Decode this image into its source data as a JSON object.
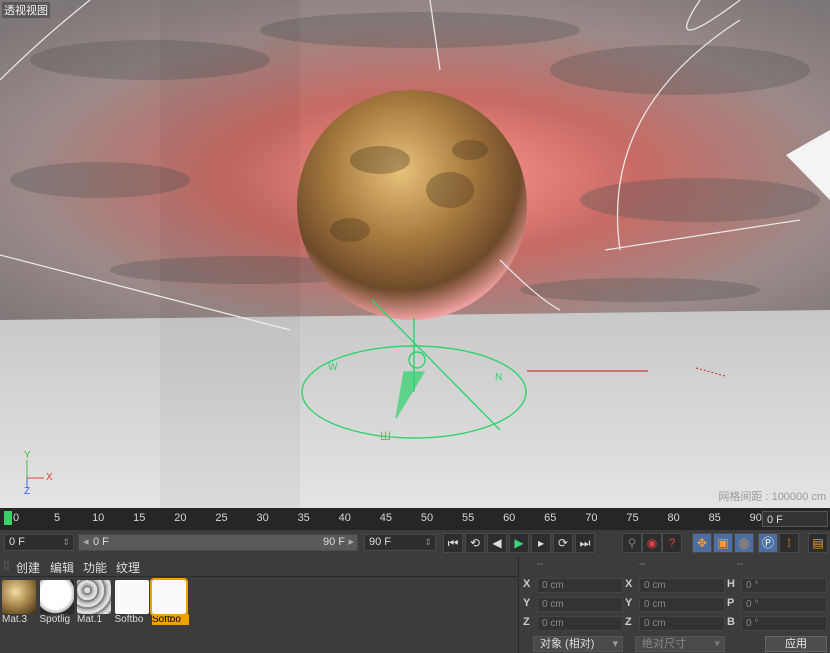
{
  "viewport": {
    "title": "透视视图",
    "grid_spacing": "网格间距 : 100000 cm",
    "axes": {
      "y": "Y",
      "x": "X",
      "z": "Z"
    },
    "colors": {
      "sky_red": "#e0716a",
      "ground": "#d9d9d9",
      "selection": "#2fd36d",
      "axis_x": "#e04040",
      "axis_y": "#40c040",
      "axis_z": "#4060ff"
    }
  },
  "timeline": {
    "ticks": [
      "0",
      "5",
      "10",
      "15",
      "20",
      "25",
      "30",
      "35",
      "40",
      "45",
      "50",
      "55",
      "60",
      "65",
      "70",
      "75",
      "80",
      "85",
      "90"
    ],
    "current_frame": "0 F"
  },
  "transport": {
    "start_field": "0 F",
    "range_start": "0 F",
    "range_end": "90 F",
    "end_field": "90 F",
    "buttons": [
      {
        "name": "goto-start",
        "glyph": "⏮"
      },
      {
        "name": "prev-key",
        "glyph": "⟲"
      },
      {
        "name": "prev-frame",
        "glyph": "◀"
      },
      {
        "name": "play",
        "glyph": "▶"
      },
      {
        "name": "next-frame",
        "glyph": "▸"
      },
      {
        "name": "next-key",
        "glyph": "⟳"
      },
      {
        "name": "goto-end",
        "glyph": "⏭"
      }
    ]
  },
  "materials": {
    "menu": [
      "创建",
      "编辑",
      "功能",
      "纹理"
    ],
    "items": [
      {
        "name": "Mat.3",
        "swatch": "gold"
      },
      {
        "name": "Spotlig",
        "swatch": "white-sphere"
      },
      {
        "name": "Mat.1",
        "swatch": "noise"
      },
      {
        "name": "Softbo",
        "swatch": "white"
      },
      {
        "name": "Softbo",
        "swatch": "white",
        "selected": true
      }
    ]
  },
  "attributes": {
    "headers": [
      "--",
      "--",
      "--"
    ],
    "rows": [
      [
        {
          "k": "X",
          "v": "0 cm"
        },
        {
          "k": "X",
          "v": "0 cm"
        },
        {
          "k": "H",
          "v": "0 °"
        }
      ],
      [
        {
          "k": "Y",
          "v": "0 cm"
        },
        {
          "k": "Y",
          "v": "0 cm"
        },
        {
          "k": "P",
          "v": "0 °"
        }
      ],
      [
        {
          "k": "Z",
          "v": "0 cm"
        },
        {
          "k": "Z",
          "v": "0 cm"
        },
        {
          "k": "B",
          "v": "0 °"
        }
      ]
    ],
    "coord_mode": "对象 (相对)",
    "size_mode": "绝对尺寸",
    "apply_label": "应用"
  }
}
